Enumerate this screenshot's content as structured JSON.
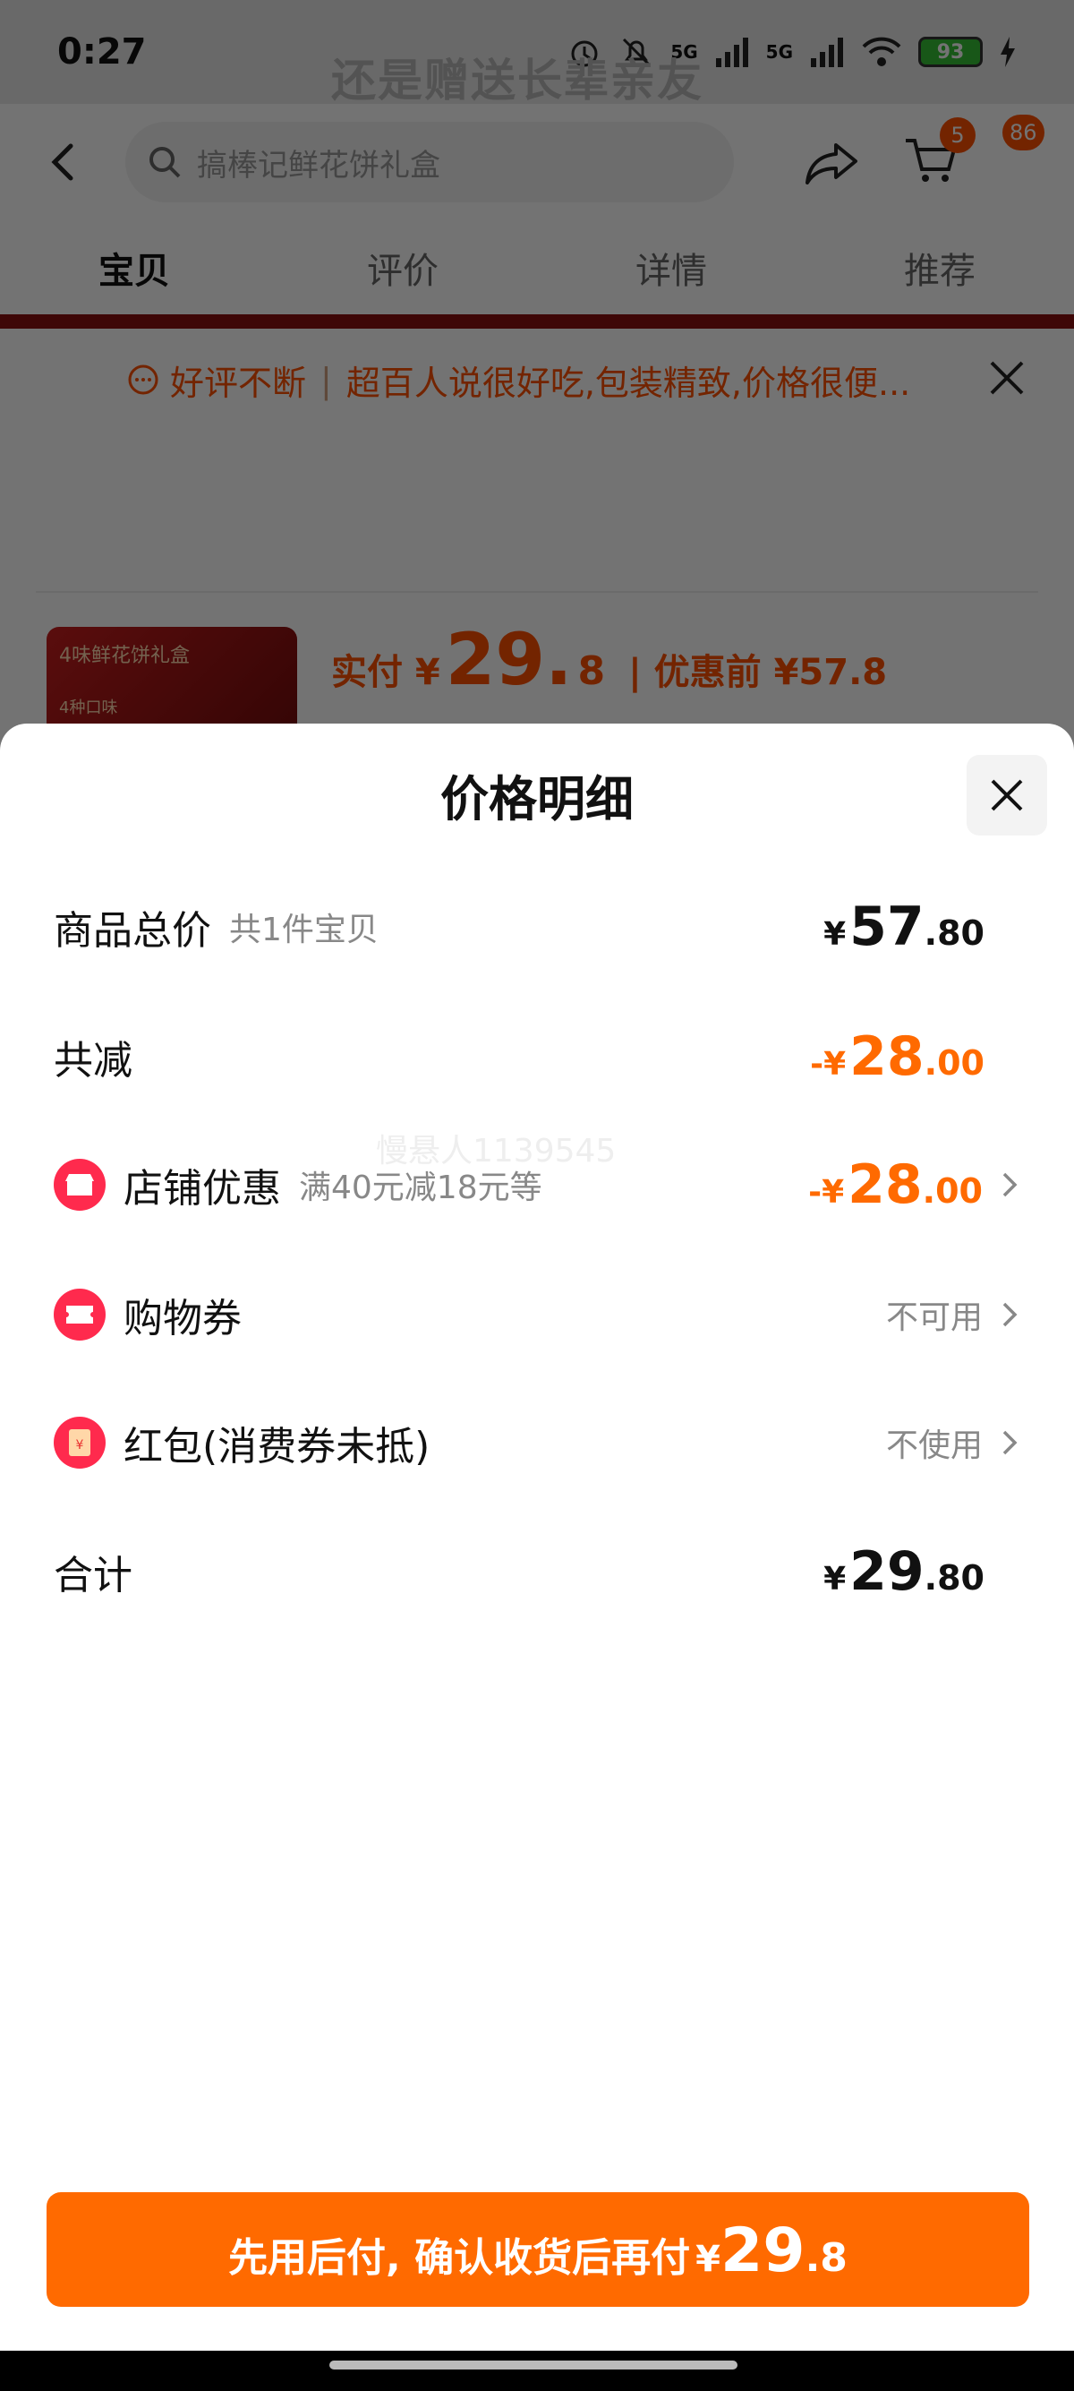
{
  "status_bar": {
    "time": "0:27",
    "battery": "93",
    "net1": "5G",
    "net2": "5G"
  },
  "background": {
    "banner_text": "还是赠送长辈亲友",
    "search_placeholder": "搞棒记鲜花饼礼盒",
    "cart_badge": "5",
    "msg_badge": "86",
    "tabs": [
      "宝贝",
      "评价",
      "详情",
      "推荐"
    ],
    "review_tag": "好评不断",
    "review_text": "超百人说很好吃,包装精致,价格很便...",
    "thumb_title": "4味鲜花饼礼盒",
    "thumb_sub": "4种口味",
    "prev_price_label": "实付 ¥",
    "prev_price_int": "29.",
    "prev_price_dec": "8",
    "prev_orig": "| 优惠前 ¥57.8"
  },
  "sheet": {
    "title": "价格明细",
    "watermark": "慢悬人1139545",
    "rows": {
      "total": {
        "label": "商品总价",
        "sub": "共1件宝贝",
        "yen": "¥",
        "int": "57",
        "dec": ".80"
      },
      "reduce": {
        "label": "共减",
        "yen": "-¥",
        "int": "28",
        "dec": ".00"
      },
      "shop": {
        "label": "店铺优惠",
        "sub": "满40元减18元等",
        "yen": "-¥",
        "int": "28",
        "dec": ".00"
      },
      "coupon": {
        "label": "购物券",
        "status": "不可用"
      },
      "redpack": {
        "label": "红包(消费券未抵)",
        "status": "不使用"
      },
      "sum": {
        "label": "合计",
        "yen": "¥",
        "int": "29",
        "dec": ".80"
      }
    },
    "pay_button": {
      "text": "先用后付, 确认收货后再付",
      "yen": "¥",
      "int": "29",
      "dec": ".8"
    }
  },
  "colors": {
    "accent": "#ff6a00",
    "icon_red": "#ff2a4d"
  }
}
